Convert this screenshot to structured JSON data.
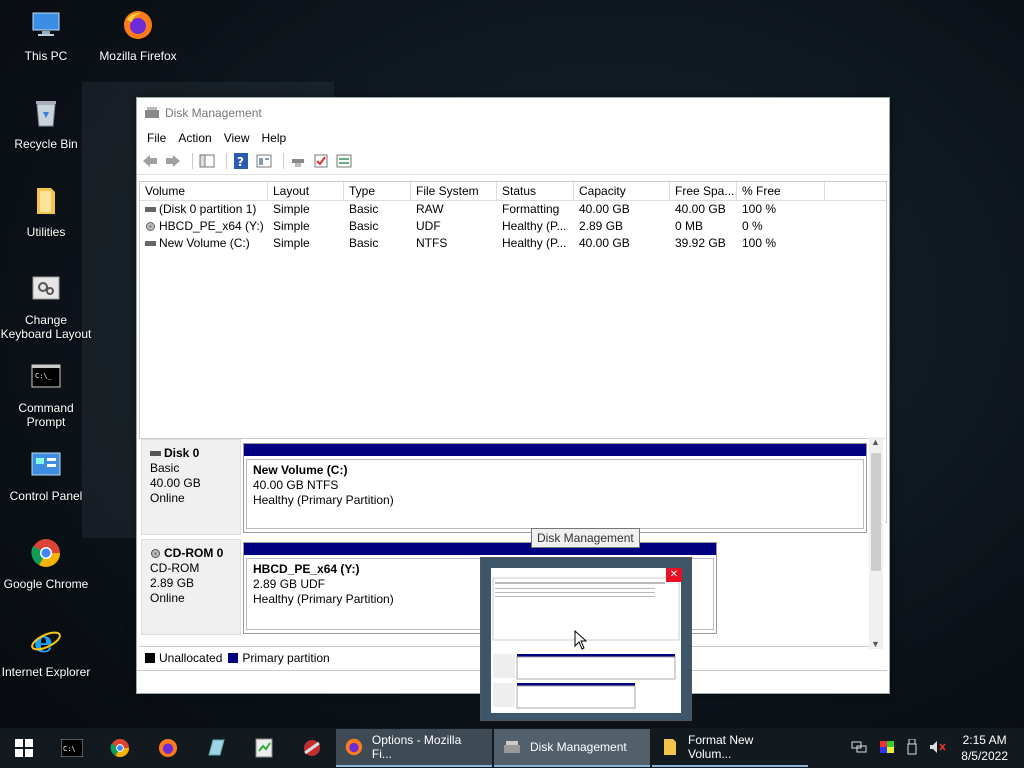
{
  "desktop": {
    "icons": [
      {
        "label": "This PC"
      },
      {
        "label": "Mozilla Firefox"
      },
      {
        "label": "Recycle Bin"
      },
      {
        "label": "Utilities"
      },
      {
        "label": "Change Keyboard Layout"
      },
      {
        "label": "Command Prompt"
      },
      {
        "label": "Control Panel"
      },
      {
        "label": "Google Chrome"
      },
      {
        "label": "Internet Explorer"
      }
    ]
  },
  "window": {
    "title": "Disk Management",
    "menu": [
      "File",
      "Action",
      "View",
      "Help"
    ],
    "columns": [
      "Volume",
      "Layout",
      "Type",
      "File System",
      "Status",
      "Capacity",
      "Free Spa...",
      "% Free"
    ],
    "volumes": [
      {
        "volume": "(Disk 0 partition 1)",
        "layout": "Simple",
        "type": "Basic",
        "fs": "RAW",
        "status": "Formatting",
        "capacity": "40.00 GB",
        "free": "40.00 GB",
        "pct": "100 %"
      },
      {
        "volume": "HBCD_PE_x64 (Y:)",
        "layout": "Simple",
        "type": "Basic",
        "fs": "UDF",
        "status": "Healthy (P...",
        "capacity": "2.89 GB",
        "free": "0 MB",
        "pct": "0 %"
      },
      {
        "volume": "New Volume (C:)",
        "layout": "Simple",
        "type": "Basic",
        "fs": "NTFS",
        "status": "Healthy (P...",
        "capacity": "40.00 GB",
        "free": "39.92 GB",
        "pct": "100 %"
      }
    ],
    "disks": [
      {
        "name": "Disk 0",
        "kind": "Basic",
        "size": "40.00 GB",
        "state": "Online",
        "partition": {
          "name": "New Volume  (C:)",
          "line2": "40.00 GB NTFS",
          "line3": "Healthy (Primary Partition)"
        }
      },
      {
        "name": "CD-ROM 0",
        "kind": "CD-ROM",
        "size": "2.89 GB",
        "state": "Online",
        "partition": {
          "name": "HBCD_PE_x64  (Y:)",
          "line2": "2.89 GB UDF",
          "line3": "Healthy (Primary Partition)"
        }
      }
    ],
    "legend": {
      "unallocated": "Unallocated",
      "primary": "Primary partition"
    }
  },
  "tooltip": "Disk Management",
  "taskbar": {
    "tasks": [
      {
        "label": "Options - Mozilla Fi..."
      },
      {
        "label": "Disk Management"
      },
      {
        "label": "Format New Volum..."
      }
    ],
    "time": "2:15 AM",
    "date": "8/5/2022"
  },
  "colors": {
    "primary_partition": "#000080",
    "unallocated": "#000000",
    "taskbar": "#121a20"
  }
}
